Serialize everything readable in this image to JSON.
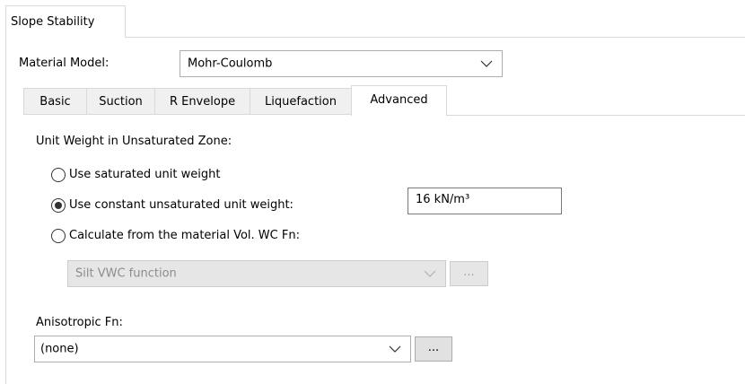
{
  "outer_tab": {
    "label": "Slope Stability"
  },
  "material_model": {
    "label": "Material Model:",
    "value": "Mohr-Coulomb"
  },
  "tabs": [
    {
      "label": "Basic"
    },
    {
      "label": "Suction"
    },
    {
      "label": "R Envelope"
    },
    {
      "label": "Liquefaction"
    },
    {
      "label": "Advanced"
    }
  ],
  "active_tab": "Advanced",
  "unit_weight": {
    "heading": "Unit Weight in Unsaturated Zone:",
    "options": [
      {
        "label": "Use saturated unit weight",
        "selected": false
      },
      {
        "label": "Use constant unsaturated unit weight:",
        "selected": true
      },
      {
        "label": "Calculate from the material Vol. WC Fn:",
        "selected": false
      }
    ],
    "constant_value": "16 kN/m³",
    "vwc_function": {
      "value": "Silt VWC function",
      "enabled": false,
      "browse_label": "..."
    }
  },
  "anisotropic": {
    "label": "Anisotropic Fn:",
    "value": "(none)",
    "browse_label": "..."
  }
}
